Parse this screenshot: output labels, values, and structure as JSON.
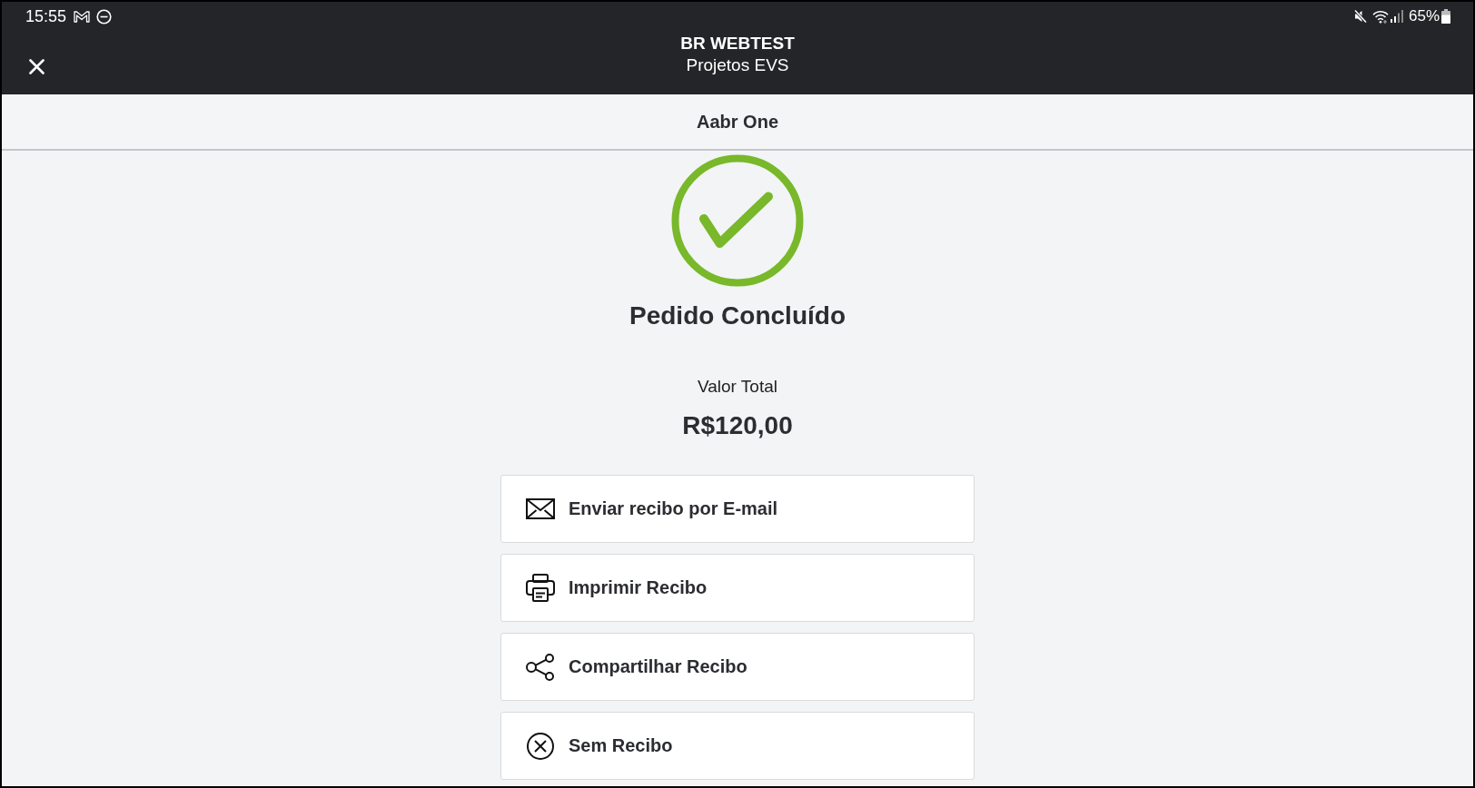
{
  "status_bar": {
    "time": "15:55",
    "battery": "65%"
  },
  "header": {
    "title": "BR WEBTEST",
    "subtitle": "Projetos EVS"
  },
  "customer": {
    "name": "Aabr One"
  },
  "order": {
    "status": "Pedido Concluído",
    "total_label": "Valor Total",
    "total_value": "R$120,00"
  },
  "receipt_options": [
    {
      "kind": "email",
      "label": "Enviar recibo por E-mail"
    },
    {
      "kind": "print",
      "label": "Imprimir Recibo"
    },
    {
      "kind": "share",
      "label": "Compartilhar Recibo"
    },
    {
      "kind": "none",
      "label": "Sem Recibo"
    }
  ]
}
